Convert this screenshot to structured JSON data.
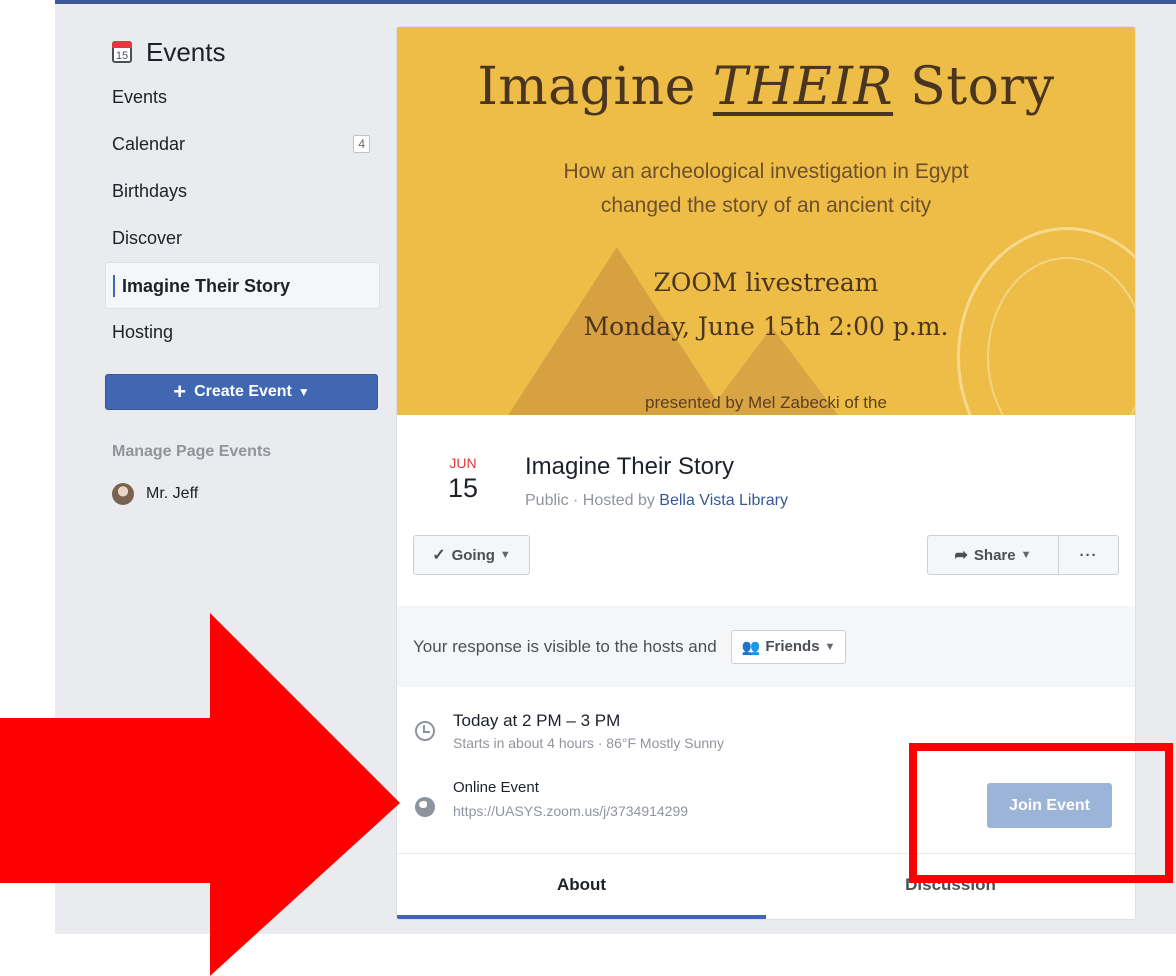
{
  "sidebar": {
    "title": "Events",
    "calendar_icon_day": "15",
    "items": [
      {
        "label": "Events"
      },
      {
        "label": "Calendar",
        "badge": "4"
      },
      {
        "label": "Birthdays"
      },
      {
        "label": "Discover"
      },
      {
        "label": "Imagine Their Story",
        "active": true
      },
      {
        "label": "Hosting"
      }
    ],
    "create_button": "Create Event",
    "manage_heading": "Manage Page Events",
    "page_name": "Mr. Jeff"
  },
  "cover": {
    "title_pre": "Imagine",
    "title_em": "THEIR",
    "title_post": "Story",
    "subtitle": "How an archeological investigation in Egypt\nchanged the story of an ancient city",
    "zoom": "ZOOM livestream\nMonday, June 15th 2:00 p.m.",
    "presenter": "presented by Mel Zabecki of the"
  },
  "event": {
    "month": "JUN",
    "day": "15",
    "title": "Imagine Their Story",
    "meta_prefix": "Public · Hosted by ",
    "host": "Bella Vista Library"
  },
  "actions": {
    "going": "Going",
    "share": "Share",
    "more": "···"
  },
  "response": {
    "text": "Your response is visible to the hosts and",
    "audience": "Friends"
  },
  "time": {
    "line1": "Today at 2 PM – 3 PM",
    "line2": "Starts in about 4 hours · 86°F Mostly Sunny"
  },
  "online": {
    "line1": "Online Event",
    "url": "https://UASYS.zoom.us/j/3734914299",
    "join": "Join Event"
  },
  "tabs": [
    "About",
    "Discussion"
  ],
  "colors": {
    "brand": "#4267b2",
    "cover_bg": "#edbd48",
    "annotation": "#ff0000"
  }
}
